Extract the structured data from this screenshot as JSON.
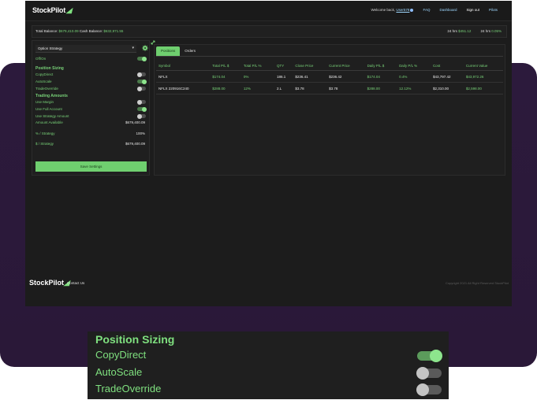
{
  "brand": {
    "name": "StockPilot"
  },
  "nav": {
    "welcome": "Welcome back,",
    "username": "User578",
    "faq": "FAQ",
    "dashboard": "Dashboard",
    "signout": "Sign out",
    "pilots": "Pilots"
  },
  "balances": {
    "total_label": "Total Balance:",
    "total_value": "$679,410.09",
    "cash_label": "Cash Balance:",
    "cash_value": "$632,971.55",
    "h24_label_1": "24 hrs",
    "h24_value_1": "$451.12",
    "h24_label_2": "24 hrs",
    "h24_value_2": "0.05%"
  },
  "left": {
    "strategy_select": "Option Strategy",
    "onoff_label": "Off/On",
    "onoff_state": true,
    "position_sizing_header": "Position Sizing",
    "copy_direct": {
      "label": "CopyDirect",
      "on": false
    },
    "auto_scale": {
      "label": "AutoScale",
      "on": true
    },
    "trade_override": {
      "label": "TradeOverride",
      "on": false
    },
    "trading_amounts_header": "Trading Amounts",
    "use_margin": {
      "label": "Use Margin",
      "on": false
    },
    "use_full_account": {
      "label": "Use Full Account",
      "on": true
    },
    "use_strategy_amount": {
      "label": "Use Strategy Amount",
      "on": false
    },
    "amount_available_label": "Amount Available",
    "amount_available_value": "$679,400.09",
    "pct_strategy_label": "% / Strategy",
    "pct_strategy_value": "100%",
    "usd_strategy_label": "$ / Strategy",
    "usd_strategy_value": "$679,400.09",
    "save_label": "Save Settings"
  },
  "tabs": [
    {
      "label": "Positions"
    },
    {
      "label": "Orders"
    }
  ],
  "table": {
    "headers": [
      "Symbol",
      "Total P/L $",
      "Total P/L %",
      "QTY",
      "Close Price",
      "Current Price",
      "Daily P/L $",
      "Daily P/L %",
      "Cost",
      "Current Value"
    ],
    "rows": [
      [
        "NFLX",
        "$174.04",
        "0%",
        "186.1",
        "$236.41",
        "$236.42",
        "$174.04",
        "0.4%",
        "$43,797.42",
        "$43,972.26"
      ],
      [
        "NFLX 220916C240",
        "$288.00",
        "12%",
        "2.L",
        "$3.78",
        "$3.78",
        "$288.00",
        "12.12%",
        "$2,310.00",
        "$2,598.00"
      ]
    ]
  },
  "footer": {
    "contact": "Contact Us",
    "copyright": "Copyright 2021 All Right Reserved StockPilot"
  },
  "zoom": {
    "header": "Position Sizing",
    "copy_direct": "CopyDirect",
    "auto_scale": "AutoScale",
    "trade_override": "TradeOverride"
  },
  "colors": {
    "accent_green": "#78d278",
    "toggle_on": "#8de58d",
    "panel_bg": "#1f1f1f",
    "purple_bg": "#2c1a3c"
  }
}
